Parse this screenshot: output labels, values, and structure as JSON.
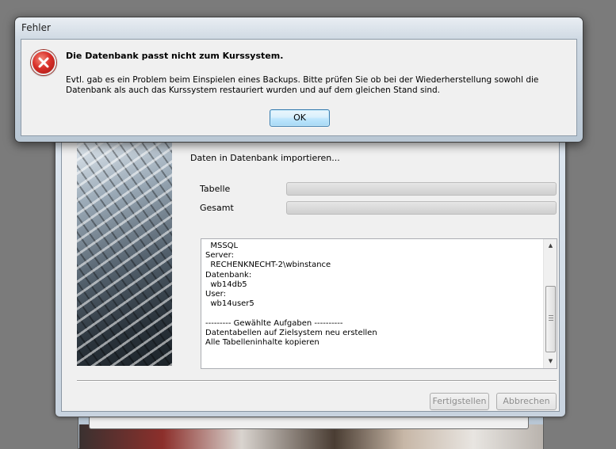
{
  "error_dialog": {
    "title": "Fehler",
    "heading": "Die Datenbank passt nicht zum Kurssystem.",
    "message": "Evtl. gab es ein Problem beim Einspielen eines Backups. Bitte prüfen Sie ob bei der Wiederherstellung sowohl die Datenbank als auch das Kurssystem restauriert wurden und auf dem gleichen Stand sind.",
    "ok_label": "OK",
    "icon": "error-icon",
    "icon_color": "#d9302a"
  },
  "wizard": {
    "status_text": "Daten in Datenbank importieren...",
    "progress_labels": {
      "table": "Tabelle",
      "total": "Gesamt"
    },
    "progress": {
      "table": 0,
      "total": 0
    },
    "log_lines": [
      "  MSSQL",
      "Server:",
      "  RECHENKNECHT-2\\wbinstance",
      "Datenbank:",
      "  wb14db5",
      "User:",
      "  wb14user5",
      "",
      "--------- Gewählte Aufgaben ----------",
      "Datentabellen auf Zielsystem neu erstellen",
      "Alle Tabelleninhalte kopieren"
    ],
    "buttons": {
      "finish": "Fertigstellen",
      "cancel": "Abbrechen"
    }
  }
}
